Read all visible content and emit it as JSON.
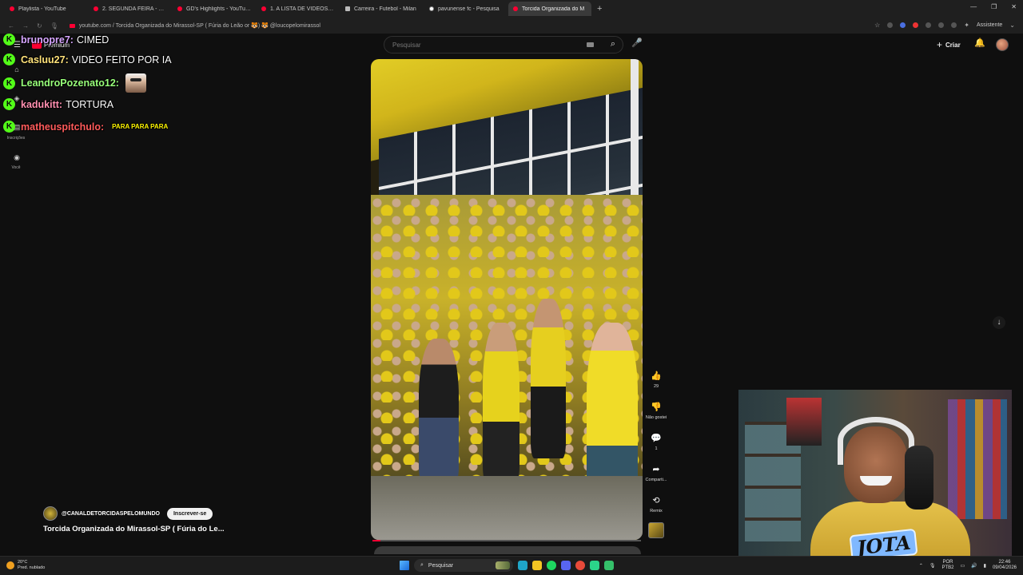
{
  "browser": {
    "tabs": [
      {
        "title": "Playlista - YouTube",
        "icon": "youtube-icon"
      },
      {
        "title": "2. SEGUNDA FEIRA - You",
        "icon": "youtube-icon"
      },
      {
        "title": "GD's Highlights - YouTube",
        "icon": "youtube-icon"
      },
      {
        "title": "1. A LISTA DE VIDEOS PA",
        "icon": "youtube-icon"
      },
      {
        "title": "Carreira - Futebol - Milan",
        "icon": "page-icon"
      },
      {
        "title": "pavunense fc - Pesquisa",
        "icon": "google-icon"
      },
      {
        "title": "Torcida Organizada do M",
        "icon": "youtube-icon"
      }
    ],
    "url": "youtube.com / Torcida Organizada do Mirassol-SP ( Fúria do Leão or 🐯) 🐯 @loucopelomirassol",
    "assistant_label": "Assistente"
  },
  "youtube": {
    "brand": "Premium",
    "search_placeholder": "Pesquisar",
    "create_label": "Criar",
    "nav": {
      "subscriptions_label": "Inscrições",
      "you_label": "Você"
    }
  },
  "chat": [
    {
      "user": "brunopre7:",
      "text": "CIMED",
      "color": "#d7a6ff"
    },
    {
      "user": "Casluu27:",
      "text": "VIDEO FEITO POR IA",
      "color": "#ffe27a"
    },
    {
      "user": "LeandroPozenato12:",
      "text": "",
      "color": "#98ff7a",
      "emote": true
    },
    {
      "user": "kadukitt:",
      "text": "TORTURA",
      "color": "#ff8fb0"
    },
    {
      "user": "matheuspitchulo:",
      "text": "PARA PARA PARA",
      "color": "#ff5b5b",
      "small": true
    }
  ],
  "short": {
    "likes": "29",
    "dislike_label": "Não gostei",
    "comments": "1",
    "share_label": "Compartilhar",
    "share_label_short": "Comparti...",
    "remix_label": "Remix",
    "channel": "@CANALDETORCIDASPELOMUNDO",
    "subscribe_label": "Inscrever-se",
    "title": "Torcida Organizada do Mirassol-SP ( Fúria do Le...",
    "progress": 0.03
  },
  "stream_overlay": {
    "logo_text": "JOTA"
  },
  "taskbar": {
    "temperature": "20°C",
    "weather": "Pred. nublado",
    "search_label": "Pesquisar",
    "lang_top": "POR",
    "lang_bottom": "PTB2",
    "time": "22:46",
    "date": "09/04/2026"
  }
}
